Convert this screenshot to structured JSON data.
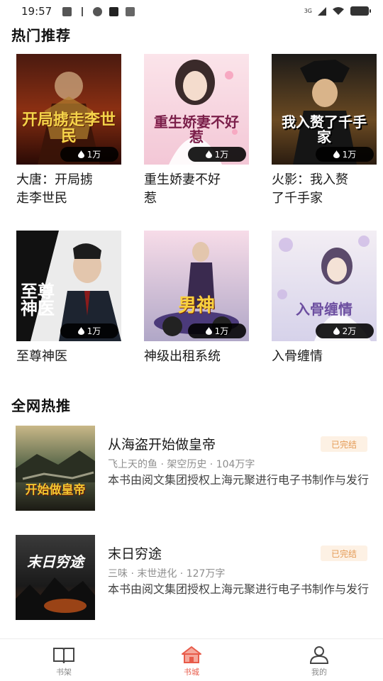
{
  "status_bar": {
    "time": "19:57",
    "network_label": "3G"
  },
  "sections": {
    "hot": {
      "title": "热门推荐"
    },
    "trending": {
      "title": "全网热推"
    }
  },
  "grid_books": [
    {
      "title": "大唐：开局掳走李世民",
      "title_lines": [
        "大唐：开局掳",
        "走李世民"
      ],
      "heat": "1万",
      "cover_text": "开局掳走李世民"
    },
    {
      "title": "重生娇妻不好惹",
      "title_lines": [
        "重生娇妻不好",
        "惹"
      ],
      "heat": "1万",
      "cover_text": "重生娇妻不好惹"
    },
    {
      "title": "火影：我入赘了千手家",
      "title_lines": [
        "火影：我入赘",
        "了千手家"
      ],
      "heat": "1万",
      "cover_text": "我入赘了千手家"
    },
    {
      "title": "至尊神医",
      "title_lines": [
        "至尊神医",
        ""
      ],
      "heat": "1万",
      "cover_text": "至尊神医"
    },
    {
      "title": "神级出租系统",
      "title_lines": [
        "神级出租系统",
        ""
      ],
      "heat": "1万",
      "cover_text": "男神"
    },
    {
      "title": "入骨缠情",
      "title_lines": [
        "入骨缠情",
        ""
      ],
      "heat": "2万",
      "cover_text": "入骨缠情"
    }
  ],
  "list_books": [
    {
      "title": "从海盗开始做皇帝",
      "status": "已完结",
      "meta": "飞上天的鱼 · 架空历史 · 104万字",
      "desc": "本书由阅文集团授权上海元聚进行电子书制作与发行",
      "cover_text": "开始做皇帝"
    },
    {
      "title": "末日穷途",
      "status": "已完结",
      "meta": "三味 · 末世进化 · 127万字",
      "desc": "本书由阅文集团授权上海元聚进行电子书制作与发行",
      "cover_text": "末日穷途"
    }
  ],
  "nav": [
    {
      "label": "书架",
      "icon": "book-icon",
      "active": false
    },
    {
      "label": "书城",
      "icon": "store-icon",
      "active": true
    },
    {
      "label": "我的",
      "icon": "user-icon",
      "active": false
    }
  ],
  "colors": {
    "accent": "#e85b4a",
    "tag_bg": "#fdf1e4",
    "tag_text": "#e49a55"
  }
}
